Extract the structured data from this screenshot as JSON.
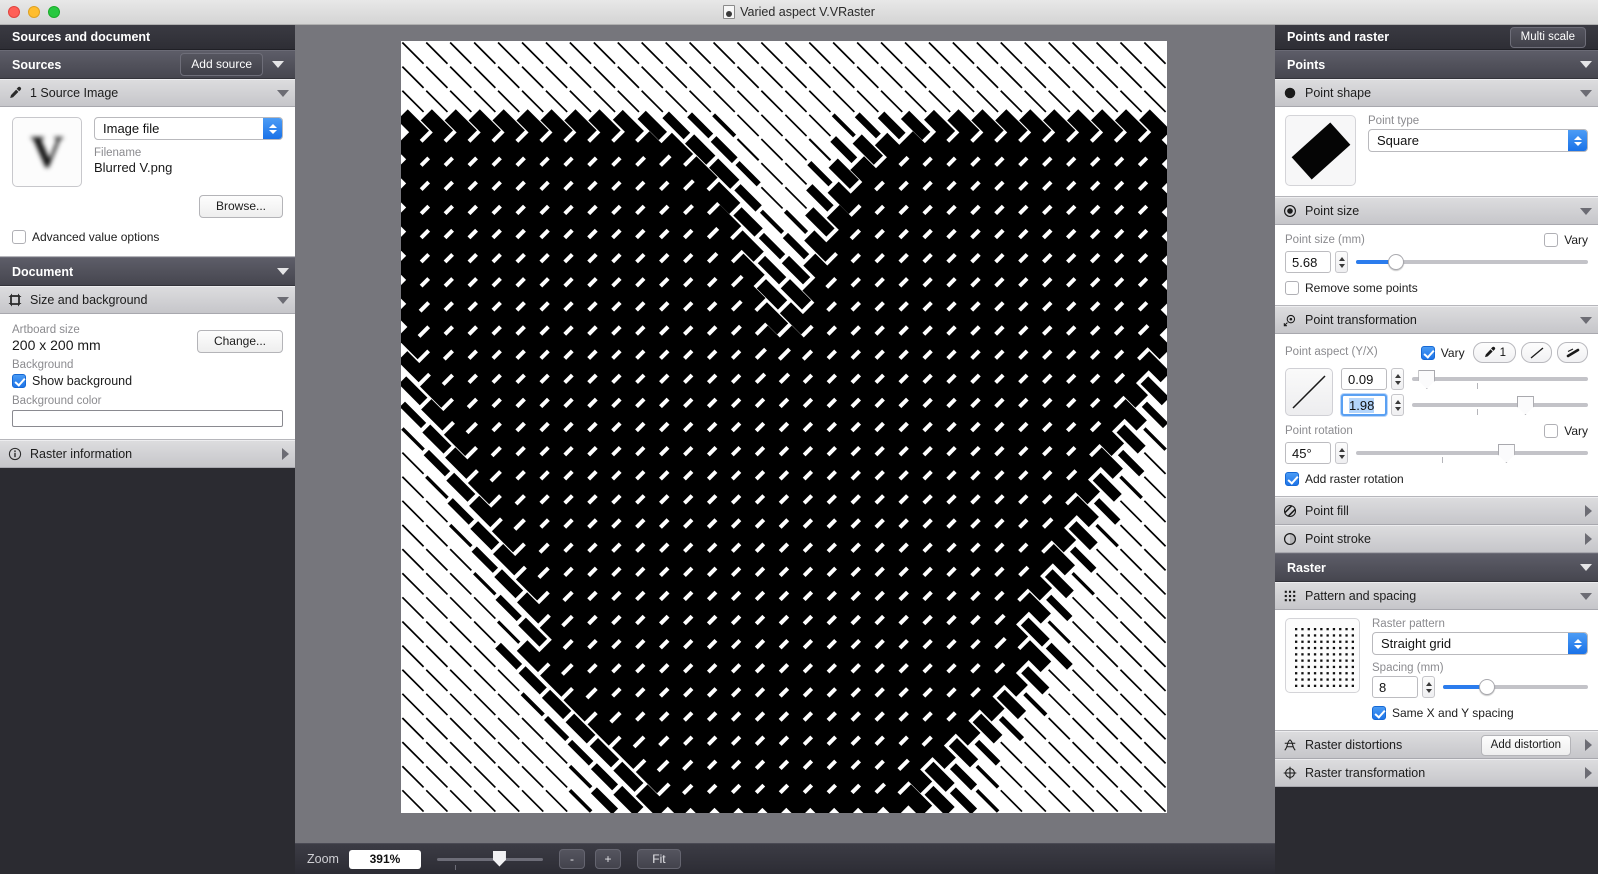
{
  "window": {
    "title": "Varied aspect V.VRaster",
    "doc_icon": "document-icon"
  },
  "left_panel": {
    "header": "Sources and document",
    "sources_group": {
      "title": "Sources",
      "add_button": "Add source"
    },
    "source_section": {
      "title": "1 Source Image",
      "icon": "eyedropper-icon",
      "source_type": "Image file",
      "filename_label": "Filename",
      "filename": "Blurred V.png",
      "browse_button": "Browse...",
      "advanced_label": "Advanced value options",
      "advanced_checked": false,
      "thumbnail_letter": "V"
    },
    "document_group": {
      "title": "Document"
    },
    "size_section": {
      "title": "Size and background",
      "icon": "artboard-icon",
      "artboard_size_label": "Artboard size",
      "artboard_size": "200 x 200 mm",
      "change_button": "Change...",
      "background_label": "Background",
      "show_background_label": "Show background",
      "show_background_checked": true,
      "background_color_label": "Background color",
      "background_color": "#ffffff"
    },
    "raster_information": {
      "title": "Raster information",
      "icon": "info-icon"
    }
  },
  "zoom_bar": {
    "label": "Zoom",
    "value": "391%",
    "minus_button": "-",
    "plus_button": "+",
    "fit_button": "Fit"
  },
  "right_panel": {
    "header": "Points and raster",
    "multi_scale_button": "Multi scale",
    "points_group": {
      "title": "Points"
    },
    "point_shape": {
      "title": "Point shape",
      "icon": "filled-circle-icon",
      "point_type_label": "Point type",
      "point_type": "Square"
    },
    "point_size": {
      "title": "Point size",
      "icon": "radio-circle-icon",
      "label": "Point size (mm)",
      "value": "5.68",
      "vary_label": "Vary",
      "vary_checked": false,
      "remove_points_label": "Remove some points",
      "remove_points_checked": false,
      "slider_percent": 15
    },
    "point_transformation": {
      "title": "Point transformation",
      "icon": "transform-icon",
      "aspect_label": "Point aspect (Y/X)",
      "aspect_vary_label": "Vary",
      "aspect_vary_checked": true,
      "eyedropper_count": "1",
      "eyedropper_icon": "eyedropper-icon",
      "curve_icon": "linear-curve-icon",
      "taper_icon": "taper-icon",
      "aspect_min": "0.09",
      "aspect_max": "1.98",
      "aspect_min_percent": 4,
      "aspect_max_percent": 66,
      "rotation_label": "Point rotation",
      "rotation_value": "45°",
      "rotation_percent": 66,
      "rotation_vary_label": "Vary",
      "rotation_vary_checked": false,
      "add_raster_rotation_label": "Add raster rotation",
      "add_raster_rotation_checked": true
    },
    "point_fill": {
      "title": "Point fill",
      "icon": "hatched-circle-icon"
    },
    "point_stroke": {
      "title": "Point stroke",
      "icon": "outline-circle-icon"
    },
    "raster_group": {
      "title": "Raster"
    },
    "pattern_spacing": {
      "title": "Pattern and spacing",
      "icon": "dot-grid-icon",
      "pattern_label": "Raster pattern",
      "pattern": "Straight grid",
      "spacing_label": "Spacing (mm)",
      "spacing": "8",
      "spacing_percent": 28,
      "same_xy_label": "Same X and Y spacing",
      "same_xy_checked": true
    },
    "raster_distortions": {
      "title": "Raster distortions",
      "icon": "distortion-icon",
      "add_button": "Add distortion"
    },
    "raster_transformation": {
      "title": "Raster transformation",
      "icon": "move-icon"
    }
  },
  "canvas": {
    "artboard_background": "#ffffff",
    "canvas_background": "#76767c",
    "point_rotation_deg": 45,
    "grid_cols": 32,
    "grid_rows": 32,
    "description": "Halftone raster of 45-degree rotated rectangles rendering a blurred letter V; dark areas use near-square points, light areas use thin elongated bars."
  }
}
